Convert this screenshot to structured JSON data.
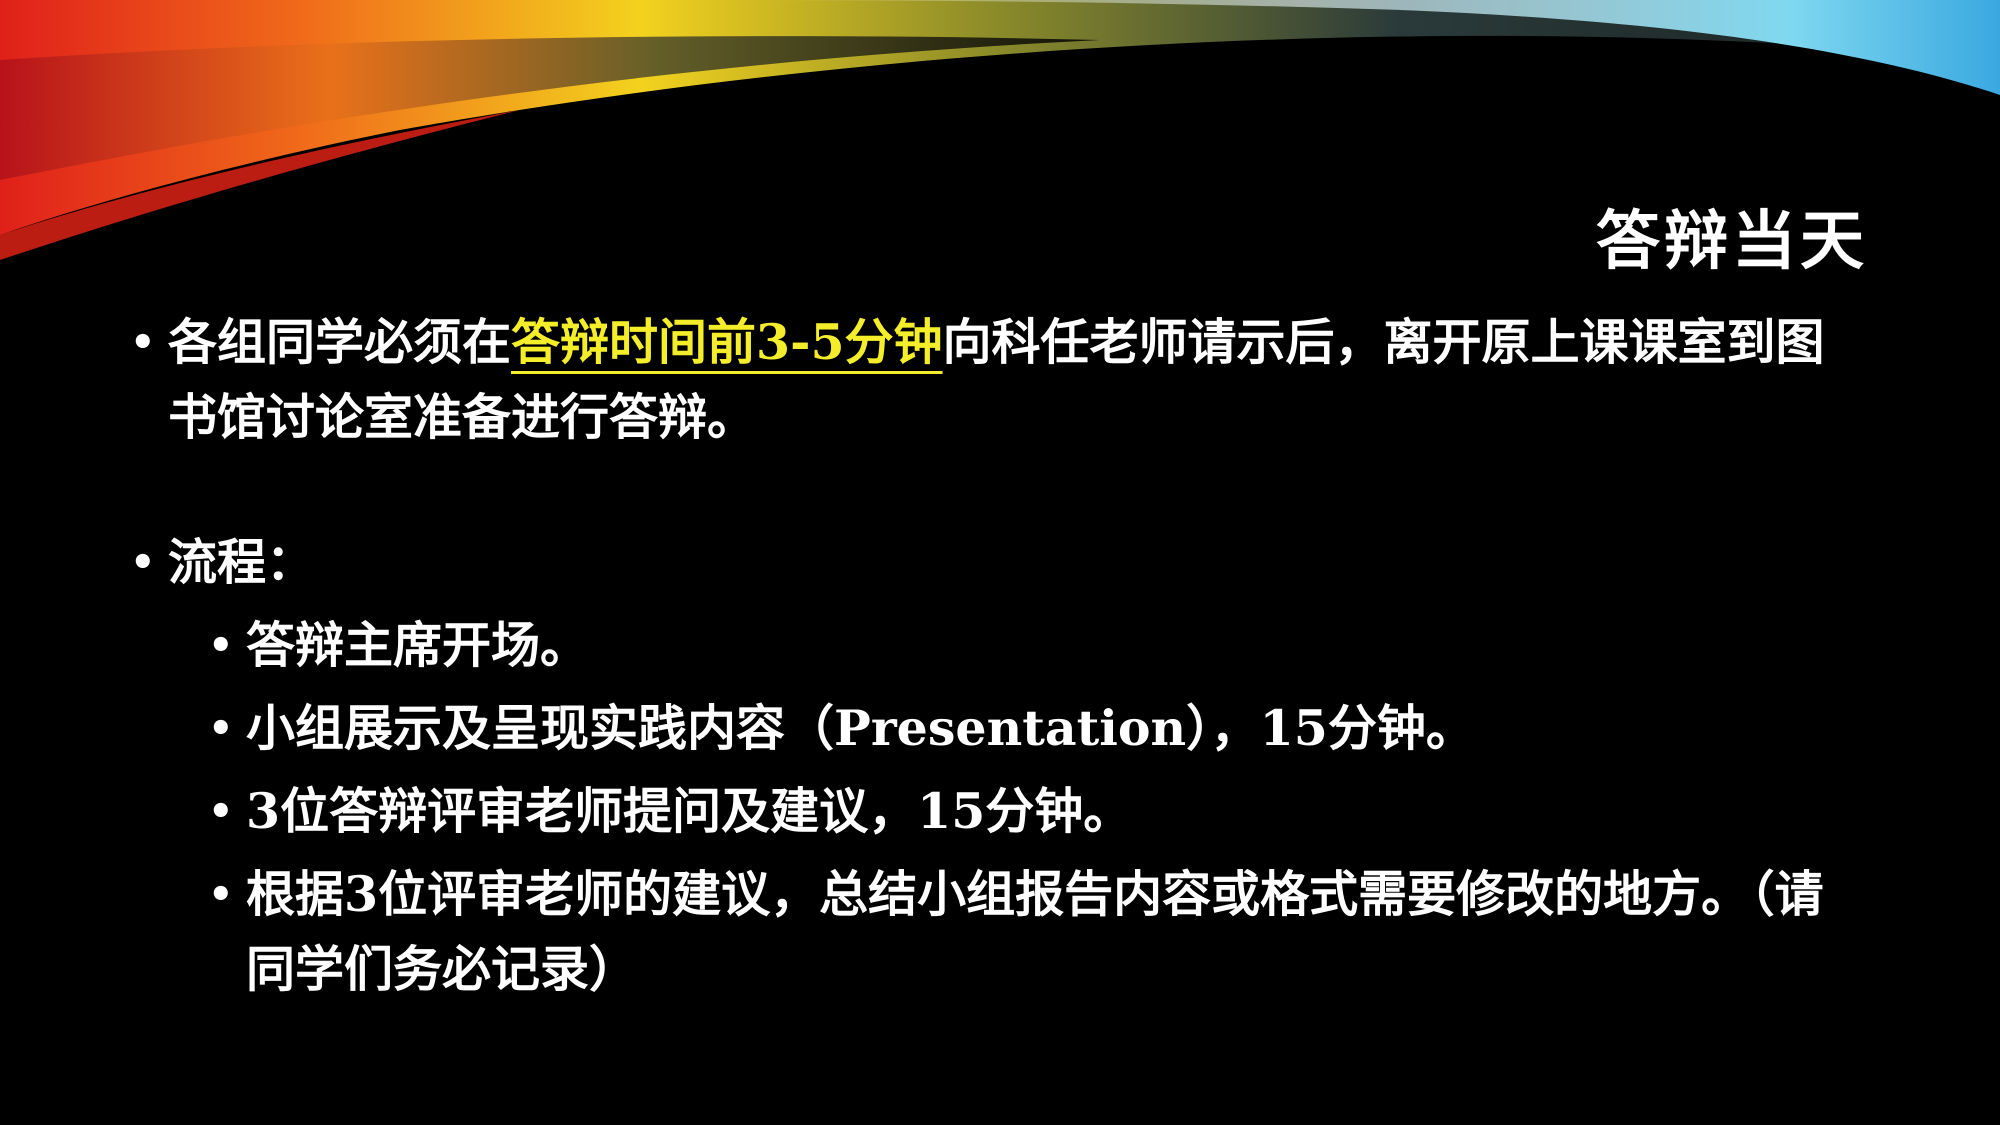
{
  "slide": {
    "title": "答辩当天",
    "p1": {
      "before": "各组同学必须在",
      "highlight": "答辩时间前3-5分钟",
      "after": "向科任老师请示后，离开原上课课室到图书馆讨论室准备进行答辩。",
      "highlight_color": "#f4ee2a"
    },
    "p2_label": "流程：",
    "sub_items": [
      "答辩主席开场。",
      "小组展示及呈现实践内容（Presentation），15分钟。",
      "3位答辩评审老师提问及建议，15分钟。",
      "根据3位评审老师的建议，总结小组报告内容或格式需要修改的地方。（请同学们务必记录）"
    ],
    "bullet": "•",
    "colors": {
      "background": "#000000",
      "text": "#ffffff",
      "highlight": "#f4ee2a"
    }
  }
}
